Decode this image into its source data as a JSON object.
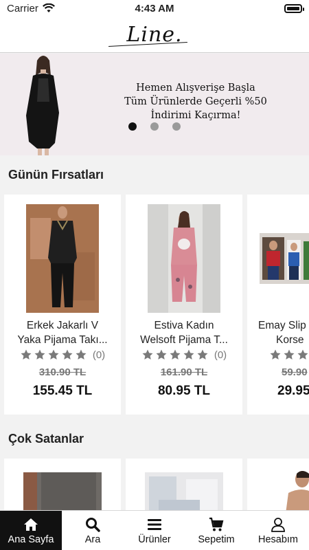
{
  "status": {
    "carrier": "Carrier",
    "time": "4:43 AM"
  },
  "header": {
    "logo": "Line."
  },
  "banner": {
    "lines": [
      "Hemen Alışverişe Başla",
      "Tüm Ürünlerde Geçerli %50",
      "İndirimi Kaçırma!"
    ],
    "dots": 3,
    "active_dot": 1
  },
  "deals": {
    "title": "Günün Fırsatları",
    "products": [
      {
        "name1": "Erkek Jakarlı V",
        "name2": "Yaka Pijama Takı...",
        "rating_count": "(0)",
        "old_price": "310.90 TL",
        "price": "155.45 TL"
      },
      {
        "name1": "Estiva Kadın",
        "name2": "Welsoft Pijama T...",
        "rating_count": "(0)",
        "old_price": "161.90 TL",
        "price": "80.95 TL"
      },
      {
        "name1": "Emay Slip",
        "name2": "Korse",
        "rating_count": "",
        "old_price": "59.90",
        "price": "29.95"
      }
    ]
  },
  "bestsellers": {
    "title": "Çok Satanlar"
  },
  "tabs": [
    {
      "label": "Ana Sayfa",
      "icon": "home-icon",
      "active": true
    },
    {
      "label": "Ara",
      "icon": "search-icon",
      "active": false
    },
    {
      "label": "Ürünler",
      "icon": "menu-icon",
      "active": false
    },
    {
      "label": "Sepetim",
      "icon": "cart-icon",
      "active": false
    },
    {
      "label": "Hesabım",
      "icon": "user-icon",
      "active": false
    }
  ],
  "colors": {
    "active_tab": "#111111",
    "banner_bg": "#f1ebee",
    "star": "#7a7a7a"
  }
}
